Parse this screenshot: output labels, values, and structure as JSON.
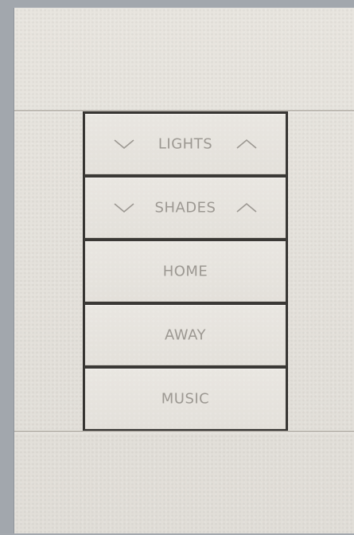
{
  "keypad": {
    "keys": [
      {
        "label": "LIGHTS",
        "has_raise_lower": true
      },
      {
        "label": "SHADES",
        "has_raise_lower": true
      },
      {
        "label": "HOME",
        "has_raise_lower": false
      },
      {
        "label": "AWAY",
        "has_raise_lower": false
      },
      {
        "label": "MUSIC",
        "has_raise_lower": false
      }
    ]
  },
  "colors": {
    "plate": "#e5e2dc",
    "label": "#9c9892",
    "wall": "#a2a7ad",
    "gap": "#3a3835"
  }
}
